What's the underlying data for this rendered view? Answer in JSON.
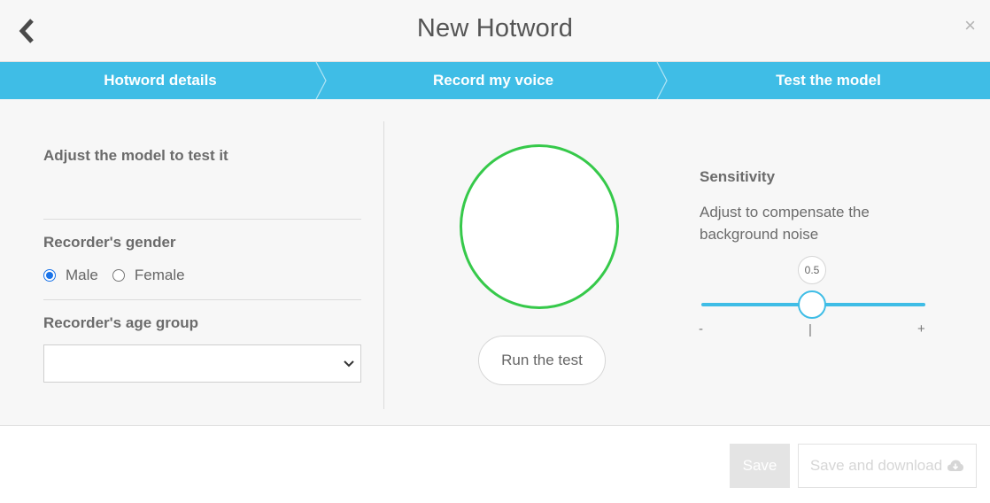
{
  "header": {
    "title": "New Hotword",
    "close_symbol": "×",
    "back_icon": "chevron-left-icon"
  },
  "steps": [
    {
      "label": "Hotword details"
    },
    {
      "label": "Record my voice"
    },
    {
      "label": "Test the model"
    }
  ],
  "left": {
    "heading": "Adjust the model to test it",
    "gender_label": "Recorder's gender",
    "gender_options": [
      {
        "label": "Male",
        "checked": true
      },
      {
        "label": "Female",
        "checked": false
      }
    ],
    "age_label": "Recorder's age group",
    "age_value": ""
  },
  "center": {
    "run_button": "Run the test"
  },
  "sensitivity": {
    "title": "Sensitivity",
    "description": "Adjust to compensate the background noise",
    "value": "0.5",
    "min_symbol": "-",
    "mid_symbol": "|",
    "max_symbol": "+"
  },
  "footer": {
    "save_label": "Save",
    "save_download_label": "Save and download"
  },
  "colors": {
    "accent": "#3fbde6",
    "circle": "#36c94a",
    "radio": "#1a73e8"
  }
}
